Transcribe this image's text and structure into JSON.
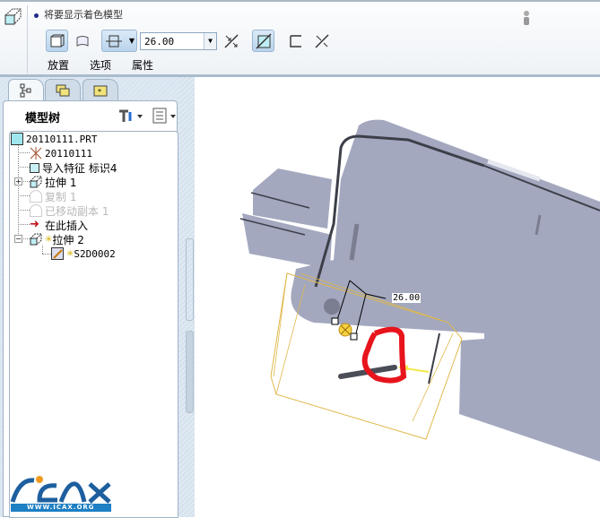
{
  "toolbar": {
    "message": "将要显示着色模型",
    "depth_value": "26.00",
    "tabs": [
      "放置",
      "选项",
      "属性"
    ]
  },
  "model_tree": {
    "title": "模型树",
    "items": [
      {
        "label": "20110111.PRT"
      },
      {
        "label": "20110111"
      },
      {
        "label": "导入特征 标识4"
      },
      {
        "label": "拉伸 1"
      },
      {
        "label": "复制 1"
      },
      {
        "label": "已移动副本 1"
      },
      {
        "label": "在此插入"
      },
      {
        "label": "拉伸 2"
      },
      {
        "label": "S2D0002"
      }
    ]
  },
  "viewport": {
    "dimension_label": "26.00"
  },
  "logo": {
    "text": "ICAX",
    "url_text": "WWW.ICAX.ORG"
  },
  "colors": {
    "part": "#a3a8bf",
    "bbox": "#e0b84a",
    "annotation": "#e8141c",
    "accent": "#9bb7d3"
  }
}
